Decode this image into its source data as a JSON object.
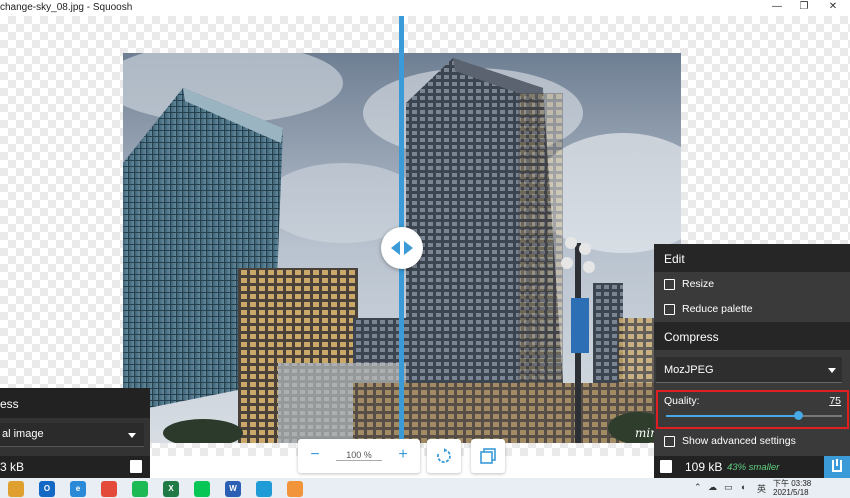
{
  "window": {
    "title": "change-sky_08.jpg - Squoosh",
    "minimize_glyph": "—",
    "restore_glyph": "❐",
    "close_glyph": "✕"
  },
  "left_panel": {
    "section_title": "ess",
    "codec_value": "al image",
    "size": "3 kB",
    "download_icon": "download-icon"
  },
  "right_panel": {
    "edit_title": "Edit",
    "resize_label": "Resize",
    "reduce_palette_label": "Reduce palette",
    "compress_title": "Compress",
    "codec_value": "MozJPEG",
    "quality_label": "Quality:",
    "quality_value": "75",
    "quality_fraction": 0.75,
    "advanced_label": "Show advanced settings",
    "size": "109 kB",
    "smaller_text": "43% smaller",
    "accent_color": "#3a9bd8",
    "highlight_color": "#e02020"
  },
  "image": {
    "watermark": "minwt"
  },
  "toolbar": {
    "zoom_out": "−",
    "zoom_level": "100 %",
    "zoom_in": "+",
    "rotate_icon": "rotate-icon",
    "view_icon": "background-toggle-icon"
  },
  "taskbar": {
    "apps": [
      {
        "name": "files-app-icon",
        "label": "",
        "color": "#e0a030"
      },
      {
        "name": "outlook-icon",
        "label": "O",
        "color": "#1368c4"
      },
      {
        "name": "ie-icon",
        "label": "e",
        "color": "#2a8ad8"
      },
      {
        "name": "chrome-icon",
        "label": "",
        "color": "#e44a3a"
      },
      {
        "name": "spotify-icon",
        "label": "",
        "color": "#1db954"
      },
      {
        "name": "excel-icon",
        "label": "X",
        "color": "#1f7a45"
      },
      {
        "name": "line-icon",
        "label": "",
        "color": "#06c755"
      },
      {
        "name": "word-icon",
        "label": "W",
        "color": "#2b5fb4"
      },
      {
        "name": "edge-icon",
        "label": "",
        "color": "#1f9bd6"
      },
      {
        "name": "squoosh-icon",
        "label": "",
        "color": "#f1943a"
      }
    ],
    "ime": "英",
    "time": "下午 03:38",
    "date": "2021/5/18"
  }
}
